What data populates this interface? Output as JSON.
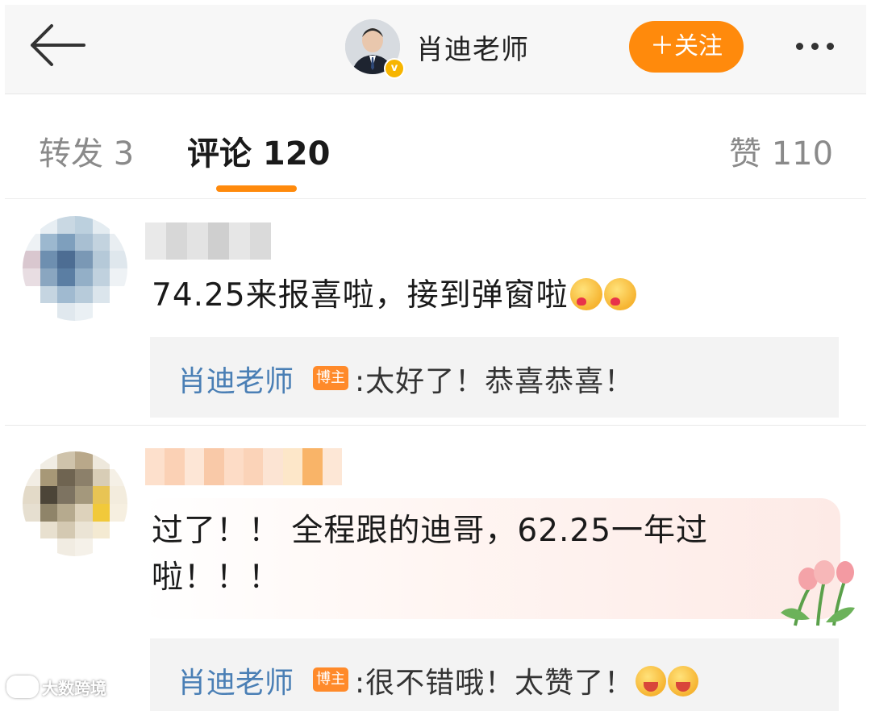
{
  "header": {
    "author_name": "肖迪老师",
    "follow_label": "＋关注",
    "verified_mark": "v"
  },
  "tabs": [
    {
      "label": "转发 3",
      "active": false
    },
    {
      "label": "评论 120",
      "active": true
    },
    {
      "label": "赞 110",
      "active": false
    }
  ],
  "comments": [
    {
      "text": "74.25来报喜啦，接到弹窗啦",
      "emojis": [
        "love-kiss-emoji",
        "love-kiss-emoji"
      ],
      "reply": {
        "name": "肖迪老师",
        "badge": "博主",
        "text": ":太好了！恭喜恭喜！"
      }
    },
    {
      "text_line1": "过了！！ 全程跟的迪哥，62.25一年过",
      "text_line2": "啦！！！",
      "reply": {
        "name": "肖迪老师",
        "badge": "博主",
        "text": ":很不错哦！太赞了！",
        "emojis": [
          "flower-joy-emoji",
          "flower-joy-emoji"
        ]
      }
    }
  ],
  "watermark": "大数跨境",
  "colors": {
    "accent_orange": "#ff8a0c",
    "link_blue": "#4a7fb5",
    "badge_orange": "#ff8a2a"
  }
}
